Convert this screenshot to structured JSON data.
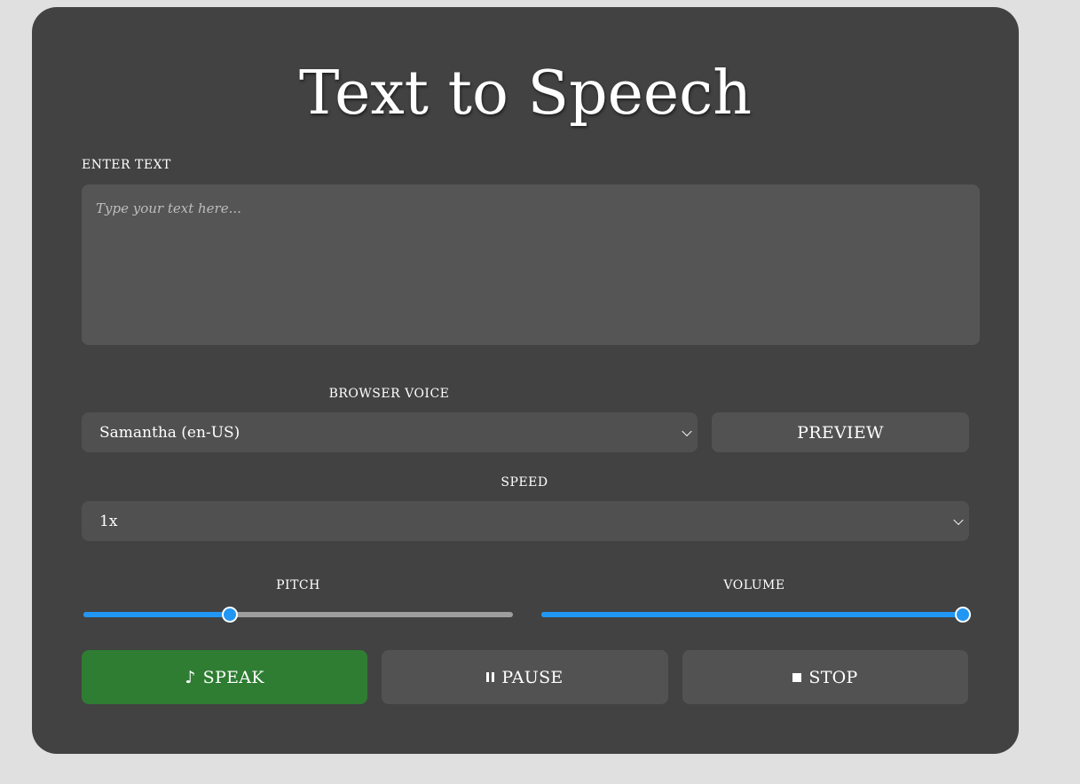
{
  "title": "Text to Speech",
  "text_input": {
    "label": "ENTER TEXT",
    "placeholder": "Type your text here..."
  },
  "voice": {
    "label": "BROWSER VOICE",
    "selected": "Samantha (en-US)",
    "preview_label": "PREVIEW"
  },
  "speed": {
    "label": "SPEED",
    "selected": "1x"
  },
  "pitch": {
    "label": "PITCH",
    "value_fraction": 0.34
  },
  "volume": {
    "label": "VOLUME",
    "value_fraction": 1.0
  },
  "buttons": {
    "speak": "SPEAK",
    "pause": "PAUSE",
    "stop": "STOP"
  },
  "colors": {
    "speak_button": "#2e7d32",
    "slider_accent": "#2196f3",
    "card_bg": "#424242"
  },
  "icons": {
    "speak": "music-note-icon",
    "pause": "pause-icon",
    "stop": "stop-icon"
  }
}
